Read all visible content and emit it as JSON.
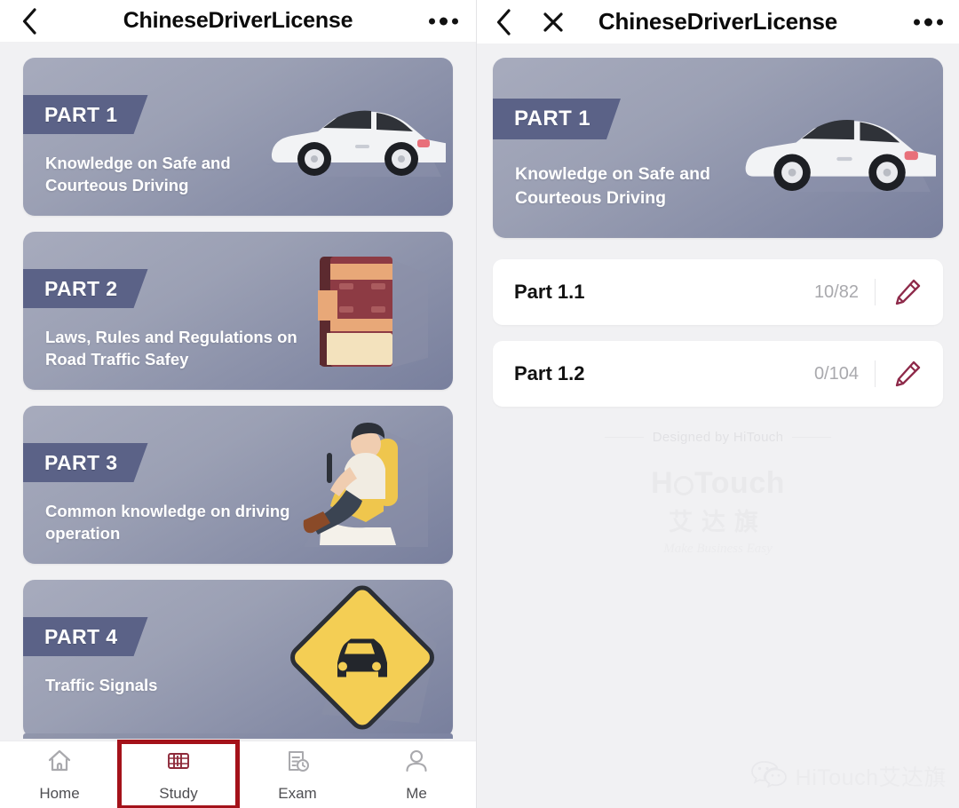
{
  "left_panel": {
    "navbar": {
      "back_icon": "chevron-left-icon",
      "title": "ChineseDriverLicense",
      "more_icon": "more-dots-icon"
    },
    "cards": [
      {
        "badge": "PART 1",
        "subtitle": "Knowledge on Safe and Courteous Driving",
        "art": "car-icon"
      },
      {
        "badge": "PART 2",
        "subtitle": "Laws, Rules and Regulations on Road Traffic Safey",
        "art": "book-icon"
      },
      {
        "badge": "PART 3",
        "subtitle": "Common knowledge on driving operation",
        "art": "driver-icon"
      },
      {
        "badge": "PART 4",
        "subtitle": "Traffic Signals",
        "art": "road-sign-icon"
      }
    ],
    "tabbar": {
      "items": [
        {
          "label": "Home",
          "icon": "home-icon",
          "active": false
        },
        {
          "label": "Study",
          "icon": "book-stack-icon",
          "active": true
        },
        {
          "label": "Exam",
          "icon": "document-clock-icon",
          "active": false
        },
        {
          "label": "Me",
          "icon": "person-icon",
          "active": false
        }
      ],
      "highlight_color": "#a4121a"
    }
  },
  "right_panel": {
    "navbar": {
      "back_icon": "chevron-left-icon",
      "close_icon": "close-x-icon",
      "title": "ChineseDriverLicense",
      "more_icon": "more-dots-icon"
    },
    "hero_card": {
      "badge": "PART 1",
      "subtitle": "Knowledge on Safe and Courteous Driving",
      "art": "car-icon"
    },
    "sections": [
      {
        "title": "Part 1.1",
        "count": "10/82",
        "action_icon": "pencil-icon"
      },
      {
        "title": "Part 1.2",
        "count": "0/104",
        "action_icon": "pencil-icon"
      }
    ],
    "watermark": {
      "designed_by": "Designed by HiTouch",
      "logo_text": "HiTouch",
      "logo_cn": "艾达旗",
      "tagline": "Make Business Easy"
    },
    "footer_watermark": {
      "icon": "wechat-icon",
      "text": "HiTouch艾达旗"
    }
  },
  "theme": {
    "card_gradient_from": "#a7abbd",
    "card_gradient_to": "#787f9d",
    "badge_color": "#5b6287",
    "accent_red": "#a4121a",
    "pencil_color": "#8e2a4a",
    "page_bg": "#f1f1f3"
  }
}
